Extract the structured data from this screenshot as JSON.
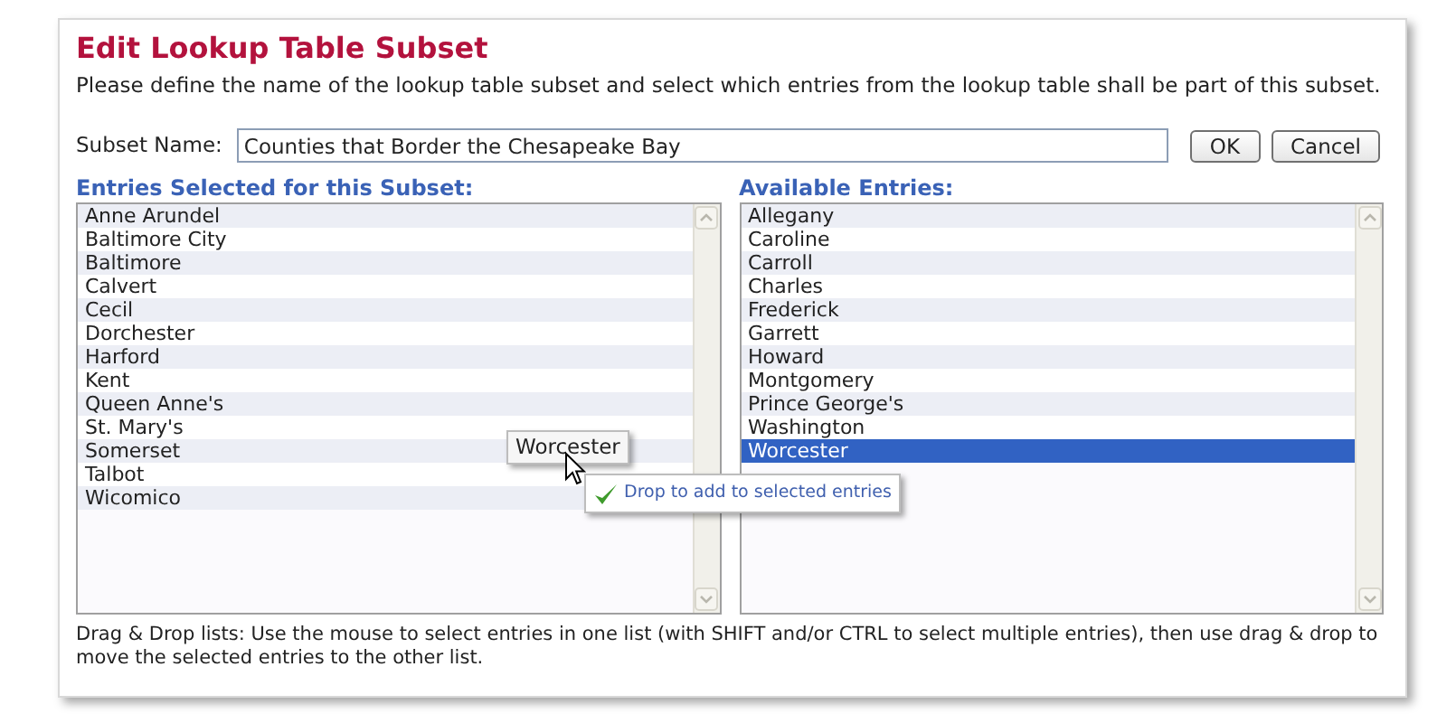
{
  "dialog": {
    "title": "Edit Lookup Table Subset",
    "description": "Please define the name of the lookup table subset and select which entries from the lookup table shall be part of this subset.",
    "name_label": "Subset Name:",
    "name_value": "Counties that Border the Chesapeake Bay",
    "buttons": [
      "OK",
      "Cancel"
    ]
  },
  "lists": [
    {
      "heading": "Entries Selected for this Subset:",
      "items": [
        {
          "label": "Anne Arundel",
          "selected": false
        },
        {
          "label": "Baltimore City",
          "selected": false
        },
        {
          "label": "Baltimore",
          "selected": false
        },
        {
          "label": "Calvert",
          "selected": false
        },
        {
          "label": "Cecil",
          "selected": false
        },
        {
          "label": "Dorchester",
          "selected": false
        },
        {
          "label": "Harford",
          "selected": false
        },
        {
          "label": "Kent",
          "selected": false
        },
        {
          "label": "Queen Anne's",
          "selected": false
        },
        {
          "label": "St. Mary's",
          "selected": false
        },
        {
          "label": "Somerset",
          "selected": false
        },
        {
          "label": "Talbot",
          "selected": false
        },
        {
          "label": "Wicomico",
          "selected": false
        }
      ]
    },
    {
      "heading": "Available Entries:",
      "items": [
        {
          "label": "Allegany",
          "selected": false
        },
        {
          "label": "Caroline",
          "selected": false
        },
        {
          "label": "Carroll",
          "selected": false
        },
        {
          "label": "Charles",
          "selected": false
        },
        {
          "label": "Frederick",
          "selected": false
        },
        {
          "label": "Garrett",
          "selected": false
        },
        {
          "label": "Howard",
          "selected": false
        },
        {
          "label": "Montgomery",
          "selected": false
        },
        {
          "label": "Prince George's",
          "selected": false
        },
        {
          "label": "Washington",
          "selected": false
        },
        {
          "label": "Worcester",
          "selected": true
        }
      ]
    }
  ],
  "drag": {
    "label": "Worcester",
    "hint": "Drop to add to selected entries"
  },
  "footer": "Drag & Drop lists: Use the mouse to select entries in one list (with SHIFT and/or CTRL to select multiple entries), then use drag & drop to move the selected entries to the other list."
}
